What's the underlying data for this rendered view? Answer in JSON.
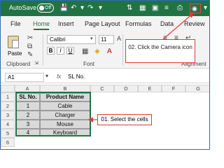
{
  "title_bar": {
    "autosave_label": "AutoSave",
    "autosave_state": "Off",
    "icons": [
      "save-icon",
      "undo-icon",
      "redo-icon",
      "camera-icon"
    ]
  },
  "tabs": [
    {
      "label": "File"
    },
    {
      "label": "Home"
    },
    {
      "label": "Insert"
    },
    {
      "label": "Page Layout"
    },
    {
      "label": "Formulas"
    },
    {
      "label": "Data"
    },
    {
      "label": "Review"
    }
  ],
  "ribbon": {
    "paste_label": "Paste",
    "clipboard_label": "Clipboard",
    "font_name": "Calibri",
    "font_size": "11",
    "font_group_label": "Font",
    "alignment_label": "Alignment",
    "bold": "B",
    "italic": "I",
    "underline": "U"
  },
  "formula_bar": {
    "name_box": "A1",
    "fx": "fx",
    "value": "SL No."
  },
  "grid": {
    "columns": [
      "A",
      "B",
      "C",
      "D",
      "E",
      "F",
      "G"
    ],
    "rows": [
      "1",
      "2",
      "3",
      "4",
      "5",
      "6"
    ],
    "headers": [
      "SL No.",
      "Product Name"
    ],
    "data": [
      [
        "1",
        "Cable"
      ],
      [
        "2",
        "Charger"
      ],
      [
        "3",
        "Mouse"
      ],
      [
        "4",
        "Keyboard"
      ]
    ]
  },
  "callouts": {
    "step1": "01. Select the cells",
    "step2": "02. Click the Camera icon"
  },
  "colors": {
    "accent": "#217346",
    "callout_border": "#e53935"
  }
}
